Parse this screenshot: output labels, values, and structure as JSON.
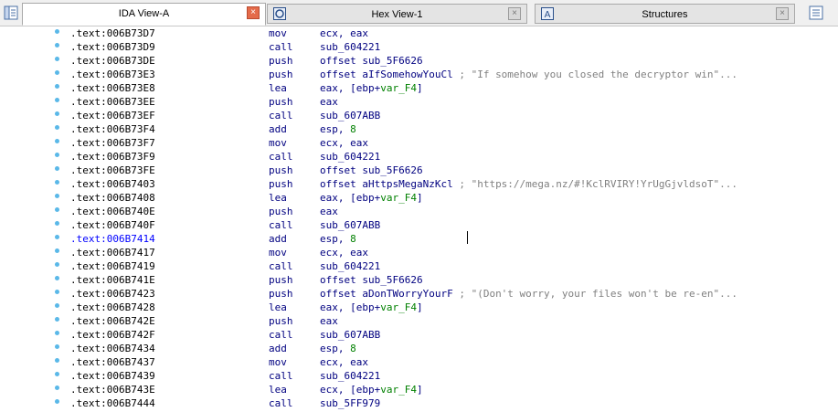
{
  "tabs": [
    {
      "label": "IDA View-A",
      "active": true,
      "icon": "ida-view-icon"
    },
    {
      "label": "Hex View-1",
      "active": false,
      "icon": "hex-view-icon"
    },
    {
      "label": "Structures",
      "active": false,
      "icon": "structures-icon"
    }
  ],
  "colors": {
    "address": "#000000",
    "address_highlight": "#0000ff",
    "mnemonic": "#000080",
    "variable": "#008000",
    "comment": "#808080"
  },
  "lines": [
    {
      "addr": ".text:006B73D7",
      "mnem": "mov",
      "op_a": "ecx, eax",
      "op_var": "",
      "op_b": "",
      "comment": ""
    },
    {
      "addr": ".text:006B73D9",
      "mnem": "call",
      "op_a": "sub_604221",
      "op_var": "",
      "op_b": "",
      "comment": ""
    },
    {
      "addr": ".text:006B73DE",
      "mnem": "push",
      "op_a": "offset sub_5F6626",
      "op_var": "",
      "op_b": "",
      "comment": ""
    },
    {
      "addr": ".text:006B73E3",
      "mnem": "push",
      "op_a": "offset aIfSomehowYouCl ",
      "op_var": "",
      "op_b": "",
      "comment": "; \"If somehow you closed the decryptor win\"..."
    },
    {
      "addr": ".text:006B73E8",
      "mnem": "lea",
      "op_a": "eax, [ebp+",
      "op_var": "var_F4",
      "op_b": "]",
      "comment": ""
    },
    {
      "addr": ".text:006B73EE",
      "mnem": "push",
      "op_a": "eax",
      "op_var": "",
      "op_b": "",
      "comment": ""
    },
    {
      "addr": ".text:006B73EF",
      "mnem": "call",
      "op_a": "sub_607ABB",
      "op_var": "",
      "op_b": "",
      "comment": ""
    },
    {
      "addr": ".text:006B73F4",
      "mnem": "add",
      "op_a": "esp, ",
      "op_var": "8",
      "op_b": "",
      "comment": ""
    },
    {
      "addr": ".text:006B73F7",
      "mnem": "mov",
      "op_a": "ecx, eax",
      "op_var": "",
      "op_b": "",
      "comment": ""
    },
    {
      "addr": ".text:006B73F9",
      "mnem": "call",
      "op_a": "sub_604221",
      "op_var": "",
      "op_b": "",
      "comment": ""
    },
    {
      "addr": ".text:006B73FE",
      "mnem": "push",
      "op_a": "offset sub_5F6626",
      "op_var": "",
      "op_b": "",
      "comment": ""
    },
    {
      "addr": ".text:006B7403",
      "mnem": "push",
      "op_a": "offset aHttpsMegaNzKcl ",
      "op_var": "",
      "op_b": "",
      "comment": "; \"https://mega.nz/#!KclRVIRY!YrUgGjvldsoT\"..."
    },
    {
      "addr": ".text:006B7408",
      "mnem": "lea",
      "op_a": "eax, [ebp+",
      "op_var": "var_F4",
      "op_b": "]",
      "comment": ""
    },
    {
      "addr": ".text:006B740E",
      "mnem": "push",
      "op_a": "eax",
      "op_var": "",
      "op_b": "",
      "comment": ""
    },
    {
      "addr": ".text:006B740F",
      "mnem": "call",
      "op_a": "sub_607ABB",
      "op_var": "",
      "op_b": "",
      "comment": ""
    },
    {
      "addr": ".text:006B7414",
      "mnem": "add",
      "op_a": "esp, ",
      "op_var": "8",
      "op_b": "",
      "comment": "",
      "highlight": true
    },
    {
      "addr": ".text:006B7417",
      "mnem": "mov",
      "op_a": "ecx, eax",
      "op_var": "",
      "op_b": "",
      "comment": ""
    },
    {
      "addr": ".text:006B7419",
      "mnem": "call",
      "op_a": "sub_604221",
      "op_var": "",
      "op_b": "",
      "comment": ""
    },
    {
      "addr": ".text:006B741E",
      "mnem": "push",
      "op_a": "offset sub_5F6626",
      "op_var": "",
      "op_b": "",
      "comment": ""
    },
    {
      "addr": ".text:006B7423",
      "mnem": "push",
      "op_a": "offset aDonTWorryYourF ",
      "op_var": "",
      "op_b": "",
      "comment": "; \"(Don't worry, your files won't be re-en\"..."
    },
    {
      "addr": ".text:006B7428",
      "mnem": "lea",
      "op_a": "eax, [ebp+",
      "op_var": "var_F4",
      "op_b": "]",
      "comment": ""
    },
    {
      "addr": ".text:006B742E",
      "mnem": "push",
      "op_a": "eax",
      "op_var": "",
      "op_b": "",
      "comment": ""
    },
    {
      "addr": ".text:006B742F",
      "mnem": "call",
      "op_a": "sub_607ABB",
      "op_var": "",
      "op_b": "",
      "comment": ""
    },
    {
      "addr": ".text:006B7434",
      "mnem": "add",
      "op_a": "esp, ",
      "op_var": "8",
      "op_b": "",
      "comment": ""
    },
    {
      "addr": ".text:006B7437",
      "mnem": "mov",
      "op_a": "ecx, eax",
      "op_var": "",
      "op_b": "",
      "comment": ""
    },
    {
      "addr": ".text:006B7439",
      "mnem": "call",
      "op_a": "sub_604221",
      "op_var": "",
      "op_b": "",
      "comment": ""
    },
    {
      "addr": ".text:006B743E",
      "mnem": "lea",
      "op_a": "ecx, [ebp+",
      "op_var": "var_F4",
      "op_b": "]",
      "comment": ""
    },
    {
      "addr": ".text:006B7444",
      "mnem": "call",
      "op_a": "sub_5FF979",
      "op_var": "",
      "op_b": "",
      "comment": ""
    }
  ]
}
